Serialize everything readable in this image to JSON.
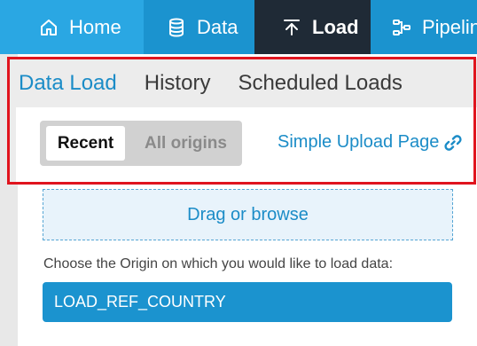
{
  "nav": {
    "home": "Home",
    "data": "Data",
    "load": "Load",
    "pipelines": "Pipelines"
  },
  "tabs": [
    "Data Load",
    "History",
    "Scheduled Loads"
  ],
  "active_tab": "Data Load",
  "segment": {
    "recent": "Recent",
    "all_origins": "All origins",
    "selected": "Recent"
  },
  "upload_link": "Simple Upload Page",
  "dropzone": "Drag or browse",
  "origin_prompt": "Choose the Origin on which you would like to load data:",
  "origin_selected": "LOAD_REF_COUNTRY",
  "icons": {
    "home": "home-icon",
    "data": "database-icon",
    "load": "upload-icon",
    "pipelines": "pipeline-icon",
    "link": "link-icon"
  },
  "colors": {
    "nav_bg": "#1b93cf",
    "nav_active_home": "#2aa7e3",
    "nav_active_load": "#1f2a36",
    "accent": "#1b8cc7",
    "highlight": "#e0141e"
  }
}
